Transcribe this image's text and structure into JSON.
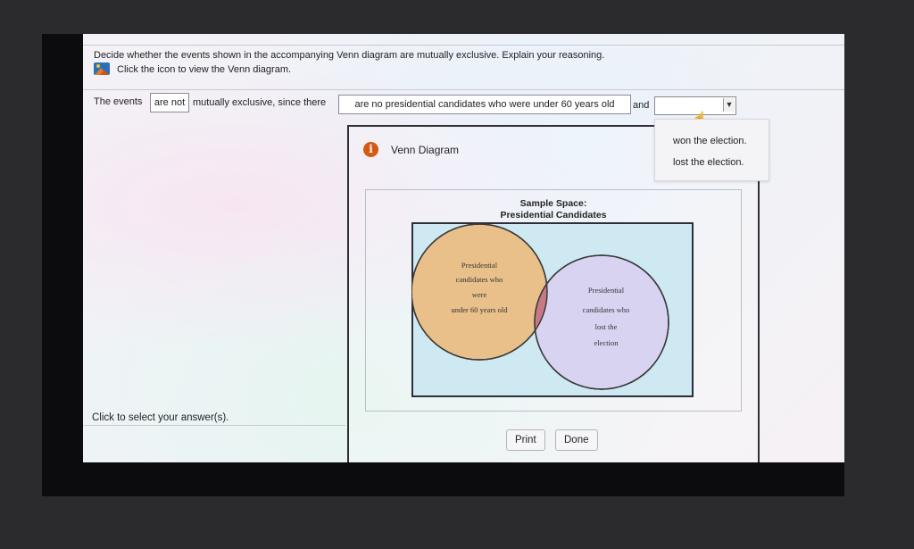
{
  "question": {
    "prompt": "Decide whether the events shown in the accompanying Venn diagram are mutually exclusive. Explain your reasoning.",
    "icon_hint": "Click the icon to view the Venn diagram.",
    "icon": "image-icon"
  },
  "answer": {
    "lead": "The events",
    "box1_value": "are not",
    "mid": "mutually exclusive, since there",
    "box2_value": "are no presidential candidates who were under 60 years old",
    "connector": "and",
    "dropdown_value": "",
    "dropdown_options": [
      "won the election.",
      "lost the election."
    ]
  },
  "venn_window": {
    "title": "Venn Diagram",
    "icon": "info-icon",
    "sample_space_line1": "Sample Space:",
    "sample_space_line2": "Presidential Candidates",
    "left_circle_lines": [
      "Presidential",
      "candidates who",
      "were",
      "under 60 years old"
    ],
    "right_circle_lines": [
      "Presidential",
      "candidates who",
      "lost the",
      "election"
    ],
    "print_label": "Print",
    "done_label": "Done",
    "colors": {
      "left_circle": "#e9c08a",
      "right_circle": "#d9d3f2",
      "overlap": "#c77a86",
      "sample_space": "#cfe9f2"
    }
  },
  "footer": {
    "hint": "Click to select your answer(s)."
  }
}
